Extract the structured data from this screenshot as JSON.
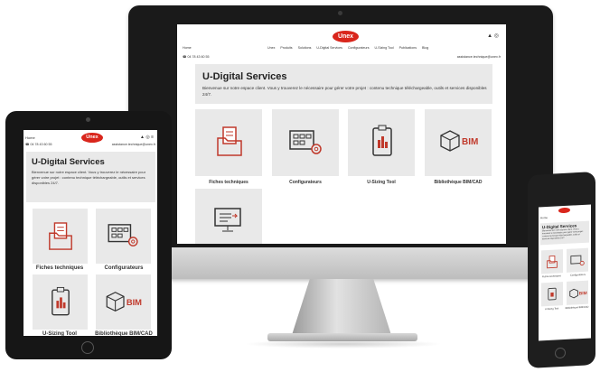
{
  "brand": {
    "logo_text": "Unex",
    "accent": "#d9261c"
  },
  "nav": {
    "home": "Home",
    "items": [
      "Unex",
      "Produits",
      "Solutions",
      "U-Digital Services",
      "Configurateurs",
      "U-Sizing Tool",
      "Publications",
      "Blog"
    ]
  },
  "contact": {
    "phone": "☎ 04 78 43 60 55",
    "email": "assistance.technique@unex.fr"
  },
  "hero": {
    "title": "U-Digital Services",
    "text": "Bienvenue sur notre espace client. Vous y trouverez le nécessaire pour gérer votre projet : contenu technique téléchargeable, outils et services disponibles 24/7."
  },
  "cards": [
    {
      "label": "Fiches techniques",
      "icon": "folder-document-icon"
    },
    {
      "label": "Configurateurs",
      "icon": "calculator-gear-icon"
    },
    {
      "label": "U-Sizing Tool",
      "icon": "clipboard-chart-icon"
    },
    {
      "label": "Bibliothèque BIM/CAD",
      "icon": "bim-cube-icon",
      "badge": "BIM"
    },
    {
      "label": "",
      "icon": "monitor-list-icon"
    }
  ],
  "icons": {
    "user": "▲",
    "globe": "◎",
    "menu": "≡"
  },
  "phone_nav": {
    "home": "Home",
    "phone_short": "04 78 43 60 55"
  }
}
